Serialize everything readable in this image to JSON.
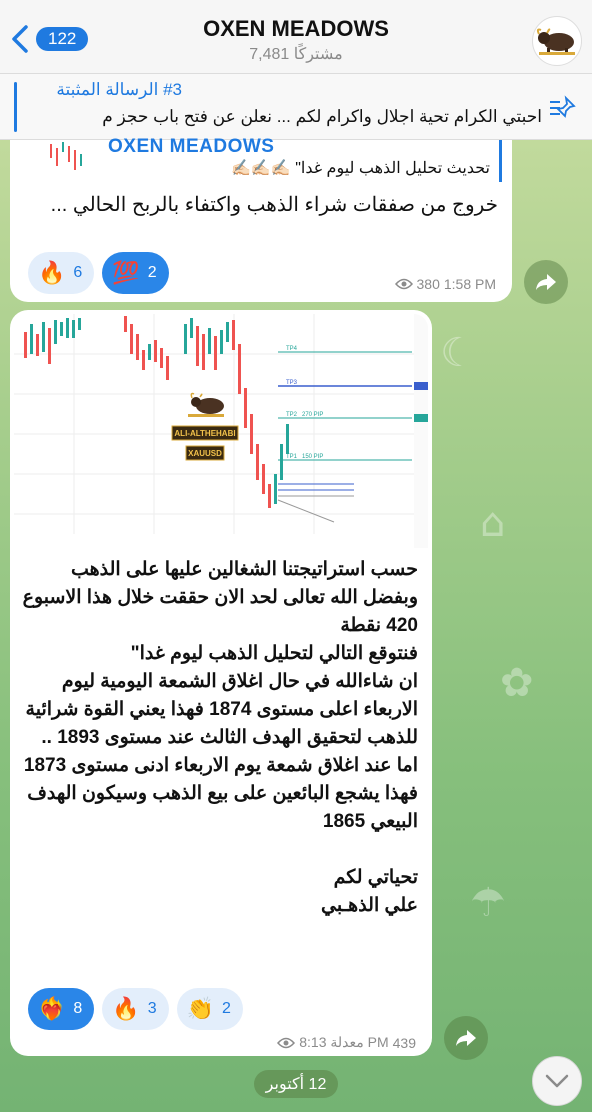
{
  "header": {
    "back_count": "122",
    "title": "OXEN MEADOWS",
    "subtitle": "7,481 مشتركًا"
  },
  "pinned": {
    "title": "#3 الرسالة المثبتة",
    "text": "احبتي الكرام تحية اجلال واكرام لكم ... نعلن عن فتح باب حجز م"
  },
  "message1": {
    "reply_author": "OXEN MEADOWS",
    "reply_text": "تحديث تحليل الذهب ليوم غدا\" ✍🏻✍🏻✍🏻",
    "text": "خروج من صفقات شراء الذهب واكتفاء بالربح الحالي ...",
    "reactions": [
      {
        "emoji": "🔥",
        "count": "6",
        "active": false
      },
      {
        "emoji": "💯",
        "count": "2",
        "active": true
      }
    ],
    "views": "380",
    "time": "1:58 PM"
  },
  "message2": {
    "chart_labels": {
      "brand": "ALI-ALTHEHABI",
      "symbol": "XAUUSD",
      "tp4": "TP4",
      "tp3": "TP3",
      "tp2": "TP2",
      "tp2_pips": "270 PIP",
      "tp1": "TP1",
      "tp1_pips": "150 PIP"
    },
    "text": "حسب استراتيجتنا الشغالين عليها على الذهب وبفضل الله تعالى  لحد الان حققت خلال هذا الاسبوع 420 نقطة\nفنتوقع التالي لتحليل الذهب ليوم غدا\"\nان شاءالله في حال اغلاق الشمعة اليومية ليوم الاربعاء اعلى مستوى 1874 فهذا يعني القوة شرائية للذهب لتحقيق الهدف الثالث عند مستوى 1893 ..\nاما عند اغلاق شمعة يوم الاربعاء ادنى مستوى 1873 فهذا يشجع البائعين على بيع الذهب وسيكون الهدف البيعي 1865\n\nتحياتي لكم\nعلي الذهـبي",
    "reactions": [
      {
        "emoji": "❤️‍🔥",
        "count": "8",
        "active": true
      },
      {
        "emoji": "🔥",
        "count": "3",
        "active": false
      },
      {
        "emoji": "👏",
        "count": "2",
        "active": false
      }
    ],
    "views": "439",
    "edited_time": "معدلة 8:13 PM"
  },
  "date_separator": "12 أكتوبر",
  "colors": {
    "accent": "#1f7ae0",
    "bull_candle": "#26a69a",
    "bear_candle": "#ef5350"
  }
}
